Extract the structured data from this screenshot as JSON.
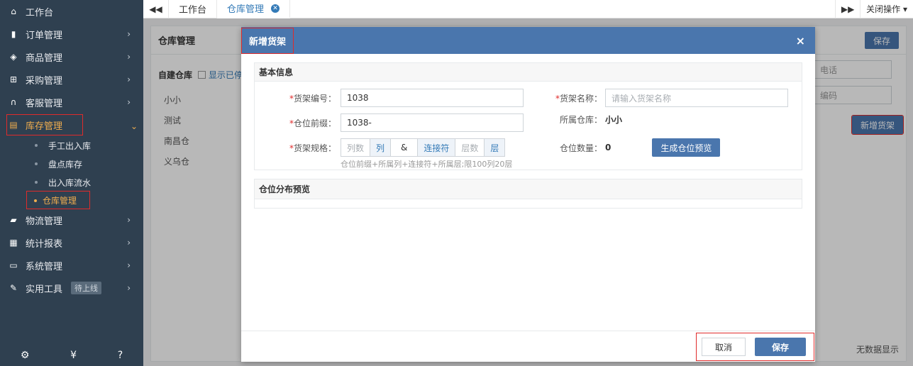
{
  "sidebar": {
    "items": [
      {
        "label": "工作台",
        "icon": "home-icon",
        "glyph": "⌂",
        "arrow": ""
      },
      {
        "label": "订单管理",
        "icon": "clipboard-icon",
        "glyph": "▮",
        "arrow": "›"
      },
      {
        "label": "商品管理",
        "icon": "cube-icon",
        "glyph": "◈",
        "arrow": "›"
      },
      {
        "label": "采购管理",
        "icon": "cart-icon",
        "glyph": "⊞",
        "arrow": "›"
      },
      {
        "label": "客服管理",
        "icon": "headset-icon",
        "glyph": "∩",
        "arrow": "›"
      },
      {
        "label": "库存管理",
        "icon": "database-icon",
        "glyph": "▤",
        "arrow": "⌄"
      }
    ],
    "subitems": [
      {
        "label": "手工出入库"
      },
      {
        "label": "盘点库存"
      },
      {
        "label": "出入库流水"
      },
      {
        "label": "仓库管理"
      }
    ],
    "items2": [
      {
        "label": "物流管理",
        "icon": "truck-icon",
        "glyph": "▰",
        "arrow": "›"
      },
      {
        "label": "统计报表",
        "icon": "report-icon",
        "glyph": "▦",
        "arrow": "›"
      },
      {
        "label": "系统管理",
        "icon": "monitor-icon",
        "glyph": "▭",
        "arrow": "›"
      },
      {
        "label": "实用工具",
        "icon": "wrench-icon",
        "glyph": "✎",
        "arrow": "›",
        "tag": "待上线"
      }
    ],
    "footer": [
      "⚙",
      "¥",
      "?"
    ]
  },
  "topbar": {
    "back": "◀◀",
    "tabs": [
      {
        "label": "工作台"
      },
      {
        "label": "仓库管理"
      }
    ],
    "forward": "▶▶",
    "close_ops": "关闭操作 ▾"
  },
  "background": {
    "panel_title": "仓库管理",
    "save": "保存",
    "self_built": "自建仓库",
    "show_enabled": "显示已停用",
    "warehouses": [
      "小小",
      "测试",
      "南昌仓",
      "义乌仓"
    ],
    "field1": "电话",
    "field2": "编码",
    "add_shelf": "新增货架",
    "no_data": "无数据显示"
  },
  "modal": {
    "title": "新增货架",
    "close": "×",
    "basic_info": "基本信息",
    "shelf_no_label": "货架编号：",
    "shelf_no_value": "1038",
    "shelf_name_label": "货架名称：",
    "shelf_name_placeholder": "请输入货架名称",
    "prefix_label": "仓位前缀：",
    "prefix_value": "1038-",
    "warehouse_label": "所属仓库：",
    "warehouse_value": "小小",
    "spec_label": "货架规格：",
    "spec": {
      "cols_ph": "列数",
      "col": "列",
      "amp": "&",
      "connector": "连接符",
      "layers_ph": "层数",
      "layer": "层"
    },
    "spec_hint": "仓位前缀+所属列+连接符+所属层;限100列20层",
    "count_label": "仓位数量：",
    "count_value": "0",
    "preview_btn": "生成仓位预览",
    "dist_preview": "仓位分布预览",
    "cancel": "取消",
    "save": "保存"
  }
}
